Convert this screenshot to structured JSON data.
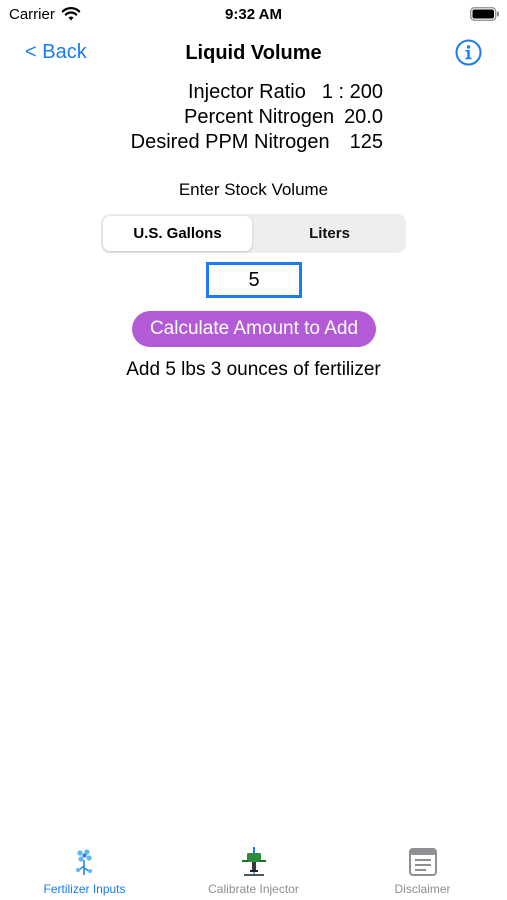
{
  "status_bar": {
    "carrier": "Carrier",
    "time": "9:32 AM"
  },
  "nav": {
    "back_label": "< Back",
    "title": "Liquid Volume",
    "info_icon": "info-circle-icon"
  },
  "info": {
    "rows": [
      {
        "label": "Injector Ratio",
        "value": "1 : 200"
      },
      {
        "label": "Percent Nitrogen",
        "value": "20.0"
      },
      {
        "label": "Desired PPM Nitrogen",
        "value": "125"
      }
    ]
  },
  "stock": {
    "prompt": "Enter Stock Volume",
    "units": [
      "U.S. Gallons",
      "Liters"
    ],
    "selected_unit": "U.S. Gallons",
    "volume_value": "5"
  },
  "actions": {
    "calculate_label": "Calculate Amount to Add"
  },
  "result": {
    "text": "Add 5 lbs 3 ounces of fertilizer"
  },
  "tabs": [
    {
      "label": "Fertilizer Inputs",
      "icon": "flowers-icon",
      "selected": true
    },
    {
      "label": "Calibrate Injector",
      "icon": "injector-icon",
      "selected": false
    },
    {
      "label": "Disclaimer",
      "icon": "document-icon",
      "selected": false
    }
  ],
  "colors": {
    "accent": "#1a7cf0",
    "button": "#b35ad6",
    "inactive_tab": "#8e8e93"
  }
}
